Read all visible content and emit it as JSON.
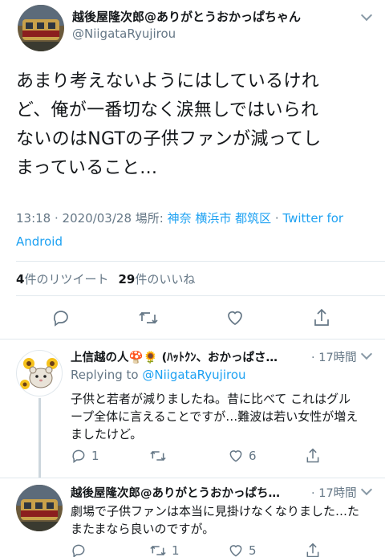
{
  "main_tweet": {
    "display_name": "越後屋隆次郎@ありがとうおかっぱちゃん",
    "handle": "@NiigataRyujirou",
    "text_lines": [
      "あまり考えないようにはしているけれ",
      "ど、俺が一番切なく涙無しではいられ",
      "ないのはNGTの子供ファンが減ってし",
      "まっていること…"
    ],
    "meta_time": "13:18 · 2020/03/28 場所: ",
    "meta_location": "神奈 横浜市 都筑区",
    "meta_sep": " · ",
    "meta_client": "Twitter for Android",
    "retweet_count": "4",
    "retweet_label": "件のリツイート",
    "like_count": "29",
    "like_label": "件のいいね"
  },
  "replies": [
    {
      "display_name": "上信越の人🍄🌻 (ﾊｯﾄｸﾝ、おかっぱさ…",
      "time": "· 17時間",
      "replying_label": "Replying to ",
      "replying_handle": "@NiigataRyujirou",
      "text_lines": [
        "子供と若者が減りましたね。昔に比べて これはグル",
        "ープ全体に言えることですが…難波は若い女性が増え",
        "ましたけど。"
      ],
      "reply_count": "1",
      "retweet_count": "",
      "like_count": "6"
    },
    {
      "display_name": "越後屋隆次郎@ありがとうおかっぱち…",
      "time": "· 17時間",
      "text_lines": [
        "劇場で子供ファンは本当に見掛けなくなりました…た",
        "またまなら良いのですが。"
      ],
      "reply_count": "",
      "retweet_count": "1",
      "like_count": "5"
    }
  ],
  "icons": {
    "reply": "reply-icon",
    "retweet": "retweet-icon",
    "like": "heart-icon",
    "share": "share-icon",
    "more": "chevron-down-icon"
  },
  "colors": {
    "link": "#1da1f2",
    "secondary_text": "#657786",
    "divider": "#e1e8ed",
    "icon": "#657786"
  }
}
